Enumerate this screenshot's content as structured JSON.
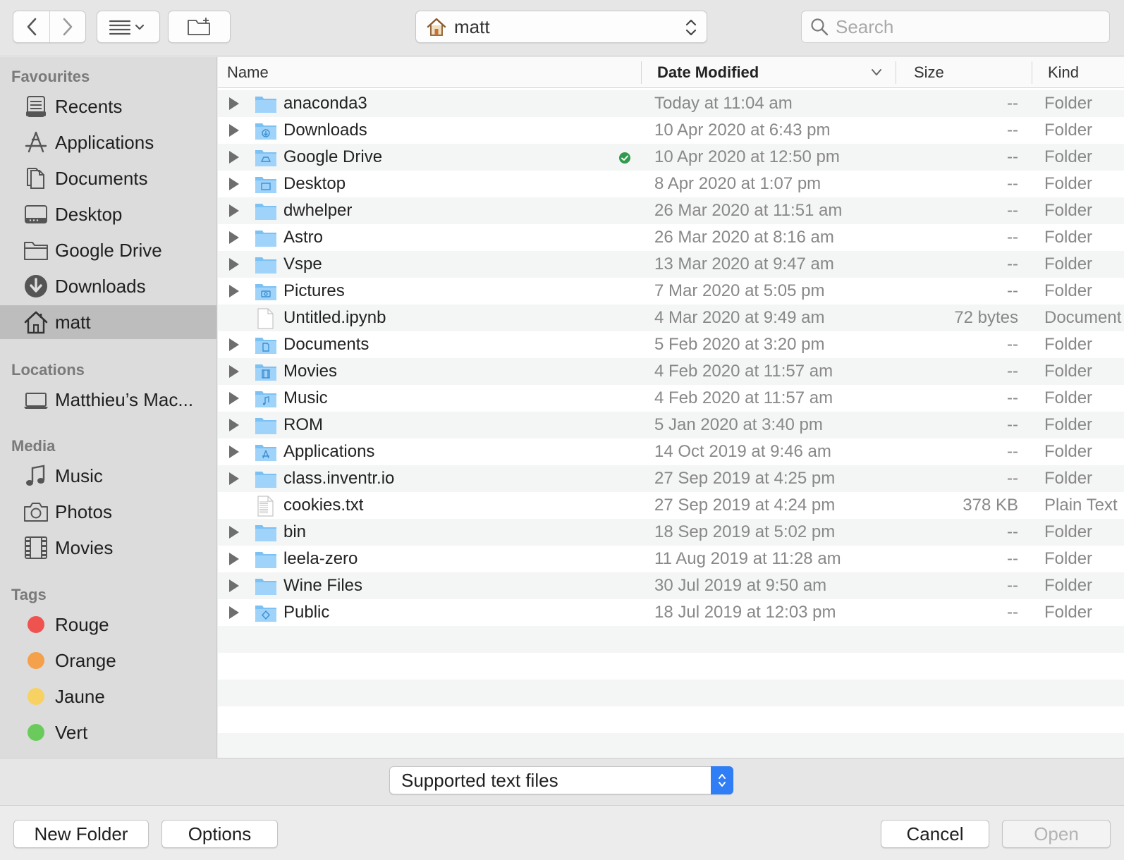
{
  "toolbar": {
    "path_label": "matt",
    "search_placeholder": "Search"
  },
  "sidebar": {
    "favourites_title": "Favourites",
    "favourites": [
      {
        "label": "Recents",
        "icon": "recents-icon"
      },
      {
        "label": "Applications",
        "icon": "applications-icon"
      },
      {
        "label": "Documents",
        "icon": "documents-icon"
      },
      {
        "label": "Desktop",
        "icon": "desktop-icon"
      },
      {
        "label": "Google Drive",
        "icon": "folder-icon"
      },
      {
        "label": "Downloads",
        "icon": "downloads-icon"
      },
      {
        "label": "matt",
        "icon": "home-icon",
        "selected": true
      }
    ],
    "locations_title": "Locations",
    "locations": [
      {
        "label": "Matthieu’s Mac...",
        "icon": "laptop-icon"
      }
    ],
    "media_title": "Media",
    "media": [
      {
        "label": "Music",
        "icon": "music-icon"
      },
      {
        "label": "Photos",
        "icon": "camera-icon"
      },
      {
        "label": "Movies",
        "icon": "film-icon"
      }
    ],
    "tags_title": "Tags",
    "tags": [
      {
        "label": "Rouge",
        "color": "#ef5350"
      },
      {
        "label": "Orange",
        "color": "#f5a04a"
      },
      {
        "label": "Jaune",
        "color": "#f7d162"
      },
      {
        "label": "Vert",
        "color": "#6acb5c"
      }
    ]
  },
  "columns": {
    "name": "Name",
    "date": "Date Modified",
    "size": "Size",
    "kind": "Kind"
  },
  "files": [
    {
      "name": "anaconda3",
      "date": "Today at 11:04 am",
      "size": "--",
      "kind": "Folder",
      "type": "folder"
    },
    {
      "name": "Downloads",
      "date": "10 Apr 2020 at 6:43 pm",
      "size": "--",
      "kind": "Folder",
      "type": "folder-downloads"
    },
    {
      "name": "Google Drive",
      "date": "10 Apr 2020 at 12:50 pm",
      "size": "--",
      "kind": "Folder",
      "type": "folder-drive",
      "synced": true
    },
    {
      "name": "Desktop",
      "date": "8 Apr 2020 at 1:07 pm",
      "size": "--",
      "kind": "Folder",
      "type": "folder-desktop"
    },
    {
      "name": "dwhelper",
      "date": "26 Mar 2020 at 11:51 am",
      "size": "--",
      "kind": "Folder",
      "type": "folder"
    },
    {
      "name": "Astro",
      "date": "26 Mar 2020 at 8:16 am",
      "size": "--",
      "kind": "Folder",
      "type": "folder"
    },
    {
      "name": "Vspe",
      "date": "13 Mar 2020 at 9:47 am",
      "size": "--",
      "kind": "Folder",
      "type": "folder"
    },
    {
      "name": "Pictures",
      "date": "7 Mar 2020 at 5:05 pm",
      "size": "--",
      "kind": "Folder",
      "type": "folder-pictures"
    },
    {
      "name": "Untitled.ipynb",
      "date": "4 Mar 2020 at 9:49 am",
      "size": "72 bytes",
      "kind": "Document",
      "type": "file"
    },
    {
      "name": "Documents",
      "date": "5 Feb 2020 at 3:20 pm",
      "size": "--",
      "kind": "Folder",
      "type": "folder-documents"
    },
    {
      "name": "Movies",
      "date": "4 Feb 2020 at 11:57 am",
      "size": "--",
      "kind": "Folder",
      "type": "folder-movies"
    },
    {
      "name": "Music",
      "date": "4 Feb 2020 at 11:57 am",
      "size": "--",
      "kind": "Folder",
      "type": "folder-music"
    },
    {
      "name": "ROM",
      "date": "5 Jan 2020 at 3:40 pm",
      "size": "--",
      "kind": "Folder",
      "type": "folder"
    },
    {
      "name": "Applications",
      "date": "14 Oct 2019 at 9:46 am",
      "size": "--",
      "kind": "Folder",
      "type": "folder-applications"
    },
    {
      "name": "class.inventr.io",
      "date": "27 Sep 2019 at 4:25 pm",
      "size": "--",
      "kind": "Folder",
      "type": "folder"
    },
    {
      "name": "cookies.txt",
      "date": "27 Sep 2019 at 4:24 pm",
      "size": "378 KB",
      "kind": "Plain Text",
      "type": "text"
    },
    {
      "name": "bin",
      "date": "18 Sep 2019 at 5:02 pm",
      "size": "--",
      "kind": "Folder",
      "type": "folder"
    },
    {
      "name": "leela-zero",
      "date": "11 Aug 2019 at 11:28 am",
      "size": "--",
      "kind": "Folder",
      "type": "folder"
    },
    {
      "name": "Wine Files",
      "date": "30 Jul 2019 at 9:50 am",
      "size": "--",
      "kind": "Folder",
      "type": "folder"
    },
    {
      "name": "Public",
      "date": "18 Jul 2019 at 12:03 pm",
      "size": "--",
      "kind": "Folder",
      "type": "folder-public"
    }
  ],
  "filter": {
    "selected": "Supported text files"
  },
  "buttons": {
    "new_folder": "New Folder",
    "options": "Options",
    "cancel": "Cancel",
    "open": "Open"
  }
}
